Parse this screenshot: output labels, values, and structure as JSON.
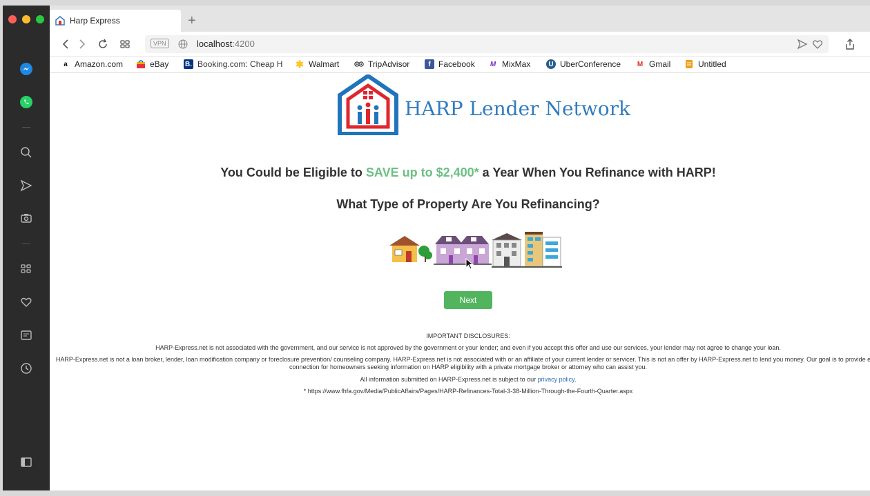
{
  "browser": {
    "tab_title": "Harp Express",
    "new_tab": "+",
    "vpn_label": "VPN",
    "url_host": "localhost",
    "url_port": ":4200"
  },
  "bookmarks": [
    {
      "label": "Amazon.com",
      "icon": "amazon-icon"
    },
    {
      "label": "eBay",
      "icon": "ebay-icon"
    },
    {
      "label": "Booking.com: Cheap H",
      "icon": "booking-icon"
    },
    {
      "label": "Walmart",
      "icon": "walmart-icon"
    },
    {
      "label": "TripAdvisor",
      "icon": "tripadvisor-icon"
    },
    {
      "label": "Facebook",
      "icon": "facebook-icon"
    },
    {
      "label": "MixMax",
      "icon": "mixmax-icon"
    },
    {
      "label": "UberConference",
      "icon": "uberconference-icon"
    },
    {
      "label": "Gmail",
      "icon": "gmail-icon"
    },
    {
      "label": "Untitled",
      "icon": "note-icon"
    }
  ],
  "page": {
    "logo_text": "HARP Lender Network",
    "headline_before": "You Could be Eligible to ",
    "headline_highlight": "SAVE up to $2,400*",
    "headline_after": " a Year When You Refinance with HARP!",
    "question": "What Type of Property Are You Refinancing?",
    "next_label": "Next",
    "disclosures_title": "IMPORTANT DISCLOSURES:",
    "disclosure_1": "HARP-Express.net is not associated with the government, and our service is not approved by the government or your lender; and even if you accept this offer and use our services, your lender may not agree to change your loan.",
    "disclosure_2": "HARP-Express.net is not a loan broker, lender, loan modification company or foreclosure prevention/ counseling company. HARP-Express.net is not associated with or an affiliate of your current lender or servicer. This is not an offer by HARP-Express.net to lend you money. Our goal is to provide easy connection for homeowners seeking information on HARP eligibility with a private mortgage broker or attorney who can assist you.",
    "disclosure_3_before": "All information submitted on HARP-Express.net is subject to our ",
    "privacy_link": "privacy policy",
    "disclosure_3_after": ".",
    "footnote": "* https://www.fhfa.gov/Media/PublicAffairs/Pages/HARP-Refinances-Total-3-38-Million-Through-the-Fourth-Quarter.aspx"
  },
  "colors": {
    "highlight": "#6cbf84",
    "brand_blue": "#2f7bc0",
    "button_green": "#52b55e"
  }
}
